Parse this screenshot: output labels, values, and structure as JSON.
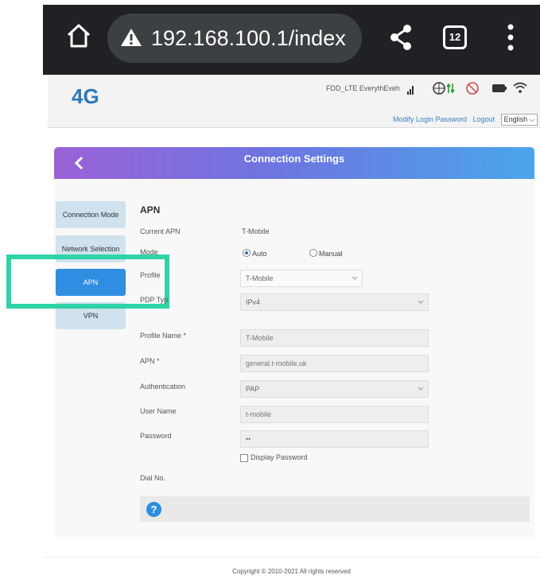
{
  "browser": {
    "url": "192.168.100.1/index",
    "tab_count": "12",
    "icons": [
      "home-icon",
      "warning-icon",
      "share-icon",
      "tabs-icon",
      "more-vertical-icon"
    ]
  },
  "header": {
    "logo": "4G",
    "network_type": "FDD_LTE",
    "carrier": "EverythEveh",
    "links": {
      "modify_password": "Modify Login Password",
      "logout": "Logout"
    },
    "language": "English"
  },
  "panel": {
    "title": "Connection Settings"
  },
  "sidebar": {
    "items": [
      {
        "label": "Connection Mode",
        "active": false
      },
      {
        "label": "Network Selection",
        "active": false
      },
      {
        "label": "APN",
        "active": true
      },
      {
        "label": "VPN",
        "active": false
      }
    ]
  },
  "form": {
    "section_title": "APN",
    "current_apn_label": "Current APN",
    "current_apn_value": "T-Mobile",
    "mode_label": "Mode",
    "mode_auto": "Auto",
    "mode_manual": "Manual",
    "mode_selected": "Auto",
    "profile_label": "Profile",
    "profile_value": "T-Mobile",
    "pdp_type_label": "PDP Typ",
    "pdp_type_value": "IPv4",
    "profile_name_label": "Profile Name *",
    "profile_name_value": "T-Mobile",
    "apn_label": "APN *",
    "apn_value": "general.t-mobile.uk",
    "auth_label": "Authentication",
    "auth_value": "PAP",
    "user_name_label": "User Name",
    "user_name_value": "t-mobile",
    "password_label": "Password",
    "password_value": "••",
    "display_password_label": "Display Password",
    "dial_no_label": "Dial No."
  },
  "help": {
    "icon": "?"
  },
  "footer": {
    "copyright": "Copyright © 2010-2021 All rights reserved"
  },
  "colors": {
    "accent": "#2f8ee2",
    "highlight": "#2ed3a8",
    "logo": "#2c78b8"
  }
}
